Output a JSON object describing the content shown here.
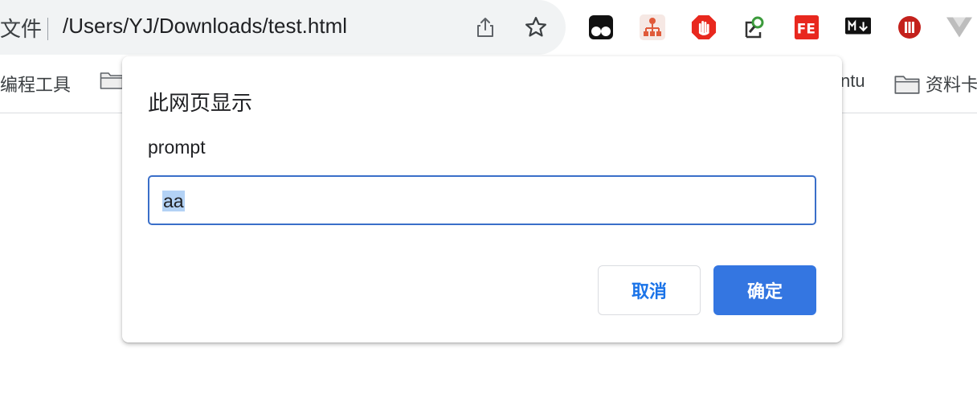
{
  "omnibox": {
    "security_label": "文件",
    "url": "/Users/YJ/Downloads/test.html"
  },
  "icons": {
    "share": "share-icon",
    "bookmark_star": "star-icon",
    "extensions": [
      "tampermonkey-extension-icon",
      "sitemap-extension-icon",
      "adblock-extension-icon",
      "search-extension-icon",
      "fe-helper-extension-icon",
      "markdown-extension-icon",
      "pause-extension-icon",
      "vue-devtools-extension-icon"
    ]
  },
  "bookmarks": {
    "first_label": "编程工具",
    "partial_label": "ntu",
    "last_label": "资料卡"
  },
  "dialog": {
    "title": "此网页显示",
    "message": "prompt",
    "input_value": "aa",
    "cancel_label": "取消",
    "ok_label": "确定"
  },
  "colors": {
    "accent": "#3476e1",
    "input_border": "#3a6fc9",
    "selection": "#b3d2f5",
    "omnibox_bg": "#f1f3f4"
  }
}
